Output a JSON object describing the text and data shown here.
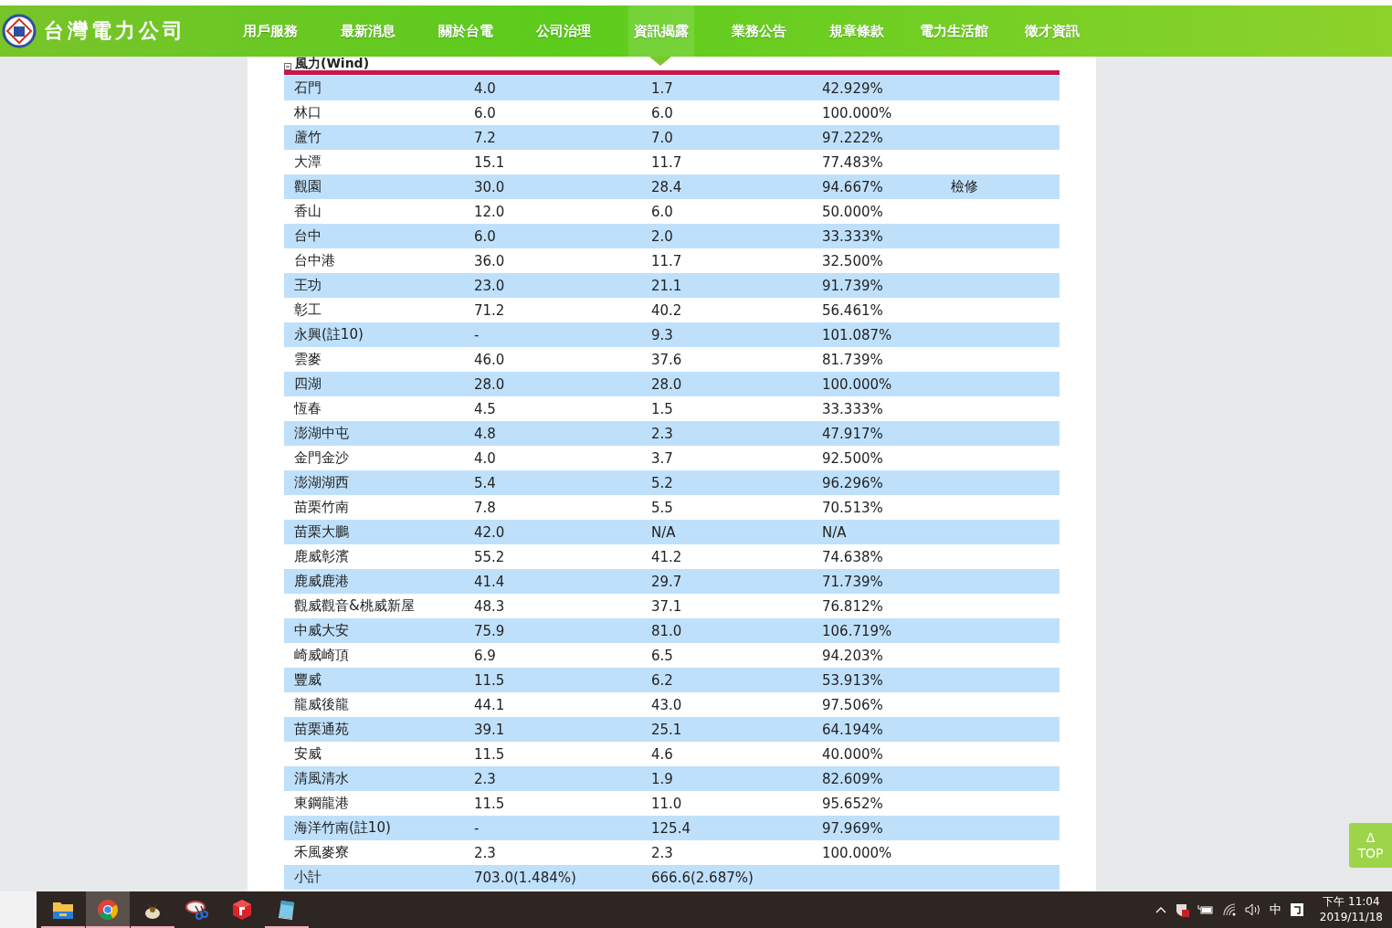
{
  "header": {
    "logo_text": "台灣電力公司",
    "nav": [
      {
        "label": "用戶服務",
        "selected": false
      },
      {
        "label": "最新消息",
        "selected": false
      },
      {
        "label": "關於台電",
        "selected": false
      },
      {
        "label": "公司治理",
        "selected": false
      },
      {
        "label": "資訊揭露",
        "selected": true
      },
      {
        "label": "業務公告",
        "selected": false
      },
      {
        "label": "規章條款",
        "selected": false
      },
      {
        "label": "電力生活館",
        "selected": false
      },
      {
        "label": "徵才資訊",
        "selected": false
      }
    ]
  },
  "section": {
    "title": "風力(Wind)",
    "rows": [
      [
        "石門",
        "4.0",
        "1.7",
        "42.929%",
        ""
      ],
      [
        "林口",
        "6.0",
        "6.0",
        "100.000%",
        ""
      ],
      [
        "蘆竹",
        "7.2",
        "7.0",
        "97.222%",
        ""
      ],
      [
        "大潭",
        "15.1",
        "11.7",
        "77.483%",
        ""
      ],
      [
        "觀園",
        "30.0",
        "28.4",
        "94.667%",
        "檢修"
      ],
      [
        "香山",
        "12.0",
        "6.0",
        "50.000%",
        ""
      ],
      [
        "台中",
        "6.0",
        "2.0",
        "33.333%",
        ""
      ],
      [
        "台中港",
        "36.0",
        "11.7",
        "32.500%",
        ""
      ],
      [
        "王功",
        "23.0",
        "21.1",
        "91.739%",
        ""
      ],
      [
        "彰工",
        "71.2",
        "40.2",
        "56.461%",
        ""
      ],
      [
        "永興(註10)",
        "-",
        "9.3",
        "101.087%",
        ""
      ],
      [
        "雲麥",
        "46.0",
        "37.6",
        "81.739%",
        ""
      ],
      [
        "四湖",
        "28.0",
        "28.0",
        "100.000%",
        ""
      ],
      [
        "恆春",
        "4.5",
        "1.5",
        "33.333%",
        ""
      ],
      [
        "澎湖中屯",
        "4.8",
        "2.3",
        "47.917%",
        ""
      ],
      [
        "金門金沙",
        "4.0",
        "3.7",
        "92.500%",
        ""
      ],
      [
        "澎湖湖西",
        "5.4",
        "5.2",
        "96.296%",
        ""
      ],
      [
        "苗栗竹南",
        "7.8",
        "5.5",
        "70.513%",
        ""
      ],
      [
        "苗栗大鵬",
        "42.0",
        "N/A",
        "N/A",
        ""
      ],
      [
        "鹿威彰濱",
        "55.2",
        "41.2",
        "74.638%",
        ""
      ],
      [
        "鹿威鹿港",
        "41.4",
        "29.7",
        "71.739%",
        ""
      ],
      [
        "觀威觀音&桃威新屋",
        "48.3",
        "37.1",
        "76.812%",
        ""
      ],
      [
        "中威大安",
        "75.9",
        "81.0",
        "106.719%",
        ""
      ],
      [
        "崎威崎頂",
        "6.9",
        "6.5",
        "94.203%",
        ""
      ],
      [
        "豐威",
        "11.5",
        "6.2",
        "53.913%",
        ""
      ],
      [
        "龍威後龍",
        "44.1",
        "43.0",
        "97.506%",
        ""
      ],
      [
        "苗栗通苑",
        "39.1",
        "25.1",
        "64.194%",
        ""
      ],
      [
        "安威",
        "11.5",
        "4.6",
        "40.000%",
        ""
      ],
      [
        "清風清水",
        "2.3",
        "1.9",
        "82.609%",
        ""
      ],
      [
        "東鋼龍港",
        "11.5",
        "11.0",
        "95.652%",
        ""
      ],
      [
        "海洋竹南(註10)",
        "-",
        "125.4",
        "97.969%",
        ""
      ],
      [
        "禾風麥寮",
        "2.3",
        "2.3",
        "100.000%",
        ""
      ],
      [
        "小計",
        "703.0(1.484%)",
        "666.6(2.687%)",
        "",
        ""
      ]
    ]
  },
  "top_button": {
    "arrow": "Δ",
    "label": "TOP"
  },
  "taskbar": {
    "apps": [
      {
        "kind": "folder",
        "running": true,
        "selected": false
      },
      {
        "kind": "browser",
        "running": true,
        "selected": true
      },
      {
        "kind": "bird",
        "running": true,
        "selected": false
      },
      {
        "kind": "scissors",
        "running": false,
        "selected": false
      },
      {
        "kind": "cube",
        "running": false,
        "selected": false
      },
      {
        "kind": "notepad",
        "running": true,
        "selected": false
      }
    ],
    "ime": "中",
    "time": "下午 11:04",
    "date": "2019/11/18"
  }
}
